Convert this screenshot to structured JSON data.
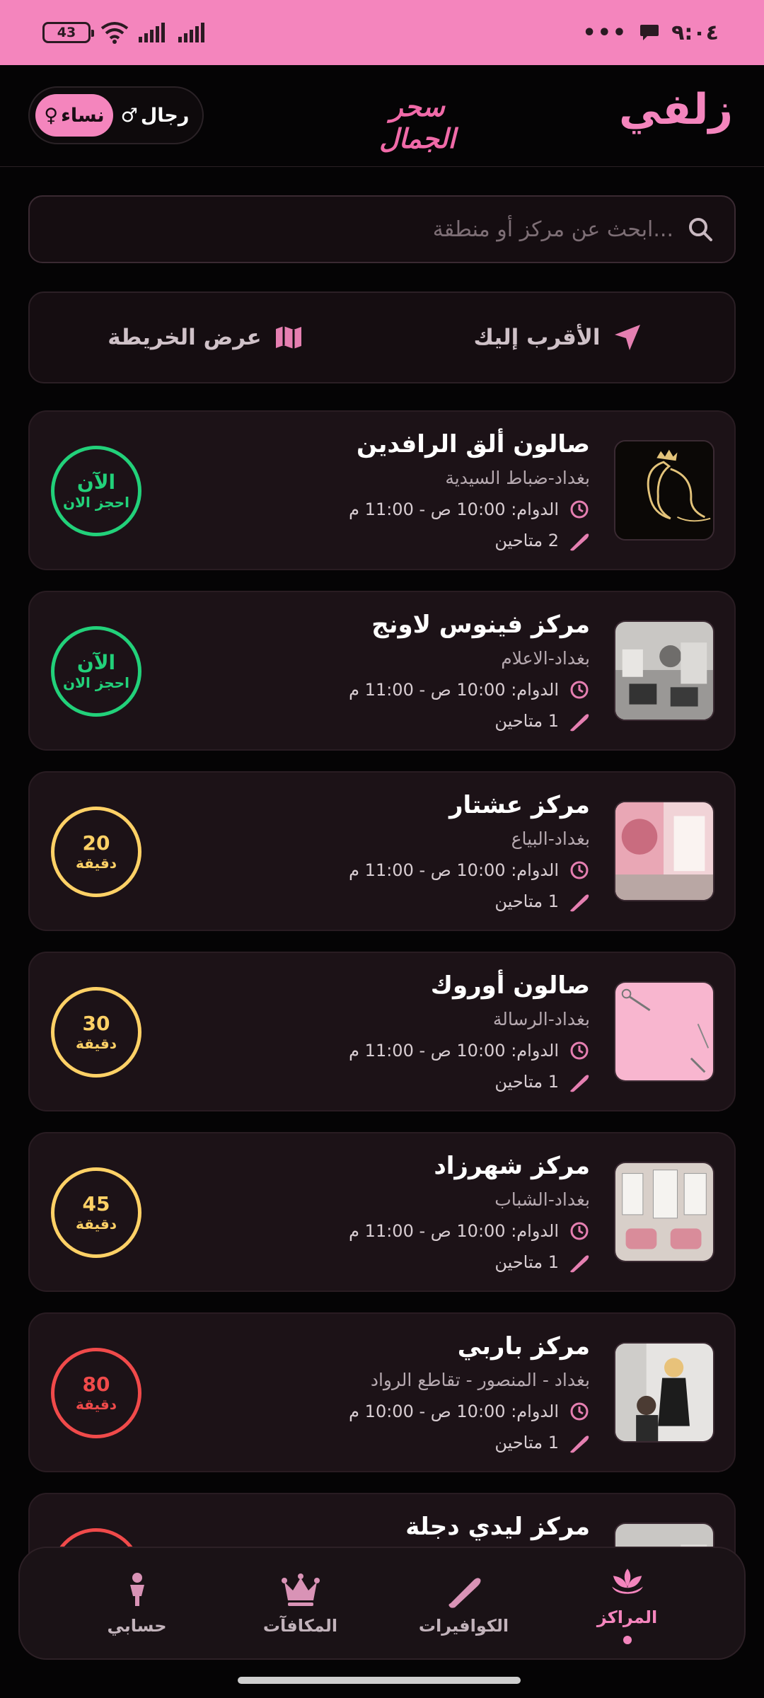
{
  "status_bar": {
    "time": "٩:٠٤",
    "battery": "43"
  },
  "header": {
    "app_title": "زلفي",
    "brand_script": "سحر الجمال",
    "gender": {
      "women": "نساء",
      "men": "رجال",
      "selected": "women"
    }
  },
  "search": {
    "placeholder": "ابحث عن مركز أو منطقة..."
  },
  "filters": {
    "nearest": "الأقرب إليك",
    "map": "عرض الخريطة"
  },
  "hours_prefix": "الدوام:",
  "salons": [
    {
      "name": "صالون ألق الرافدين",
      "location": "بغداد-ضباط السيدية",
      "hours": "الدوام: 10:00 ص - 11:00 م",
      "staff": "2 متاحين",
      "wait_top": "الآن",
      "wait_bottom": "احجز الان",
      "wait_color": "#22d17a",
      "thumb": "logo"
    },
    {
      "name": "مركز فينوس لاونج",
      "location": "بغداد-الاعلام",
      "hours": "الدوام: 10:00 ص - 11:00 م",
      "staff": "1 متاحين",
      "wait_top": "الآن",
      "wait_bottom": "احجز الان",
      "wait_color": "#22d17a",
      "thumb": "salon-grey"
    },
    {
      "name": "مركز عشتار",
      "location": "بغداد-البياع",
      "hours": "الدوام: 10:00 ص - 11:00 م",
      "staff": "1 متاحين",
      "wait_top": "20",
      "wait_bottom": "دقيقة",
      "wait_color": "#ffd166",
      "thumb": "salon-pink"
    },
    {
      "name": "صالون أوروك",
      "location": "بغداد-الرسالة",
      "hours": "الدوام: 10:00 ص - 11:00 م",
      "staff": "1 متاحين",
      "wait_top": "30",
      "wait_bottom": "دقيقة",
      "wait_color": "#ffd166",
      "thumb": "pink-tools"
    },
    {
      "name": "مركز شهرزاد",
      "location": "بغداد-الشباب",
      "hours": "الدوام: 10:00 ص - 11:00 م",
      "staff": "1 متاحين",
      "wait_top": "45",
      "wait_bottom": "دقيقة",
      "wait_color": "#ffd166",
      "thumb": "salon-mirrors"
    },
    {
      "name": "مركز باربي",
      "location": "بغداد - المنصور - تقاطع الرواد",
      "hours": "الدوام: 10:00 ص - 10:00 م",
      "staff": "1 متاحين",
      "wait_top": "80",
      "wait_bottom": "دقيقة",
      "wait_color": "#f04a4a",
      "thumb": "salon-stylist"
    },
    {
      "name": "مركز ليدي دجلة",
      "location": "",
      "hours": "",
      "staff": "",
      "wait_top": "",
      "wait_bottom": "",
      "wait_color": "#f04a4a",
      "thumb": "salon-grey"
    }
  ],
  "bottom_nav": [
    {
      "label": "حسابي",
      "icon": "person-icon"
    },
    {
      "label": "المكافآت",
      "icon": "crown-icon"
    },
    {
      "label": "الكوافيرات",
      "icon": "comb-icon"
    },
    {
      "label": "المراكز",
      "icon": "lotus-icon",
      "active": true
    }
  ],
  "colors": {
    "accent": "#f485bd",
    "now": "#22d17a",
    "medium": "#ffd166",
    "long": "#f04a4a"
  }
}
